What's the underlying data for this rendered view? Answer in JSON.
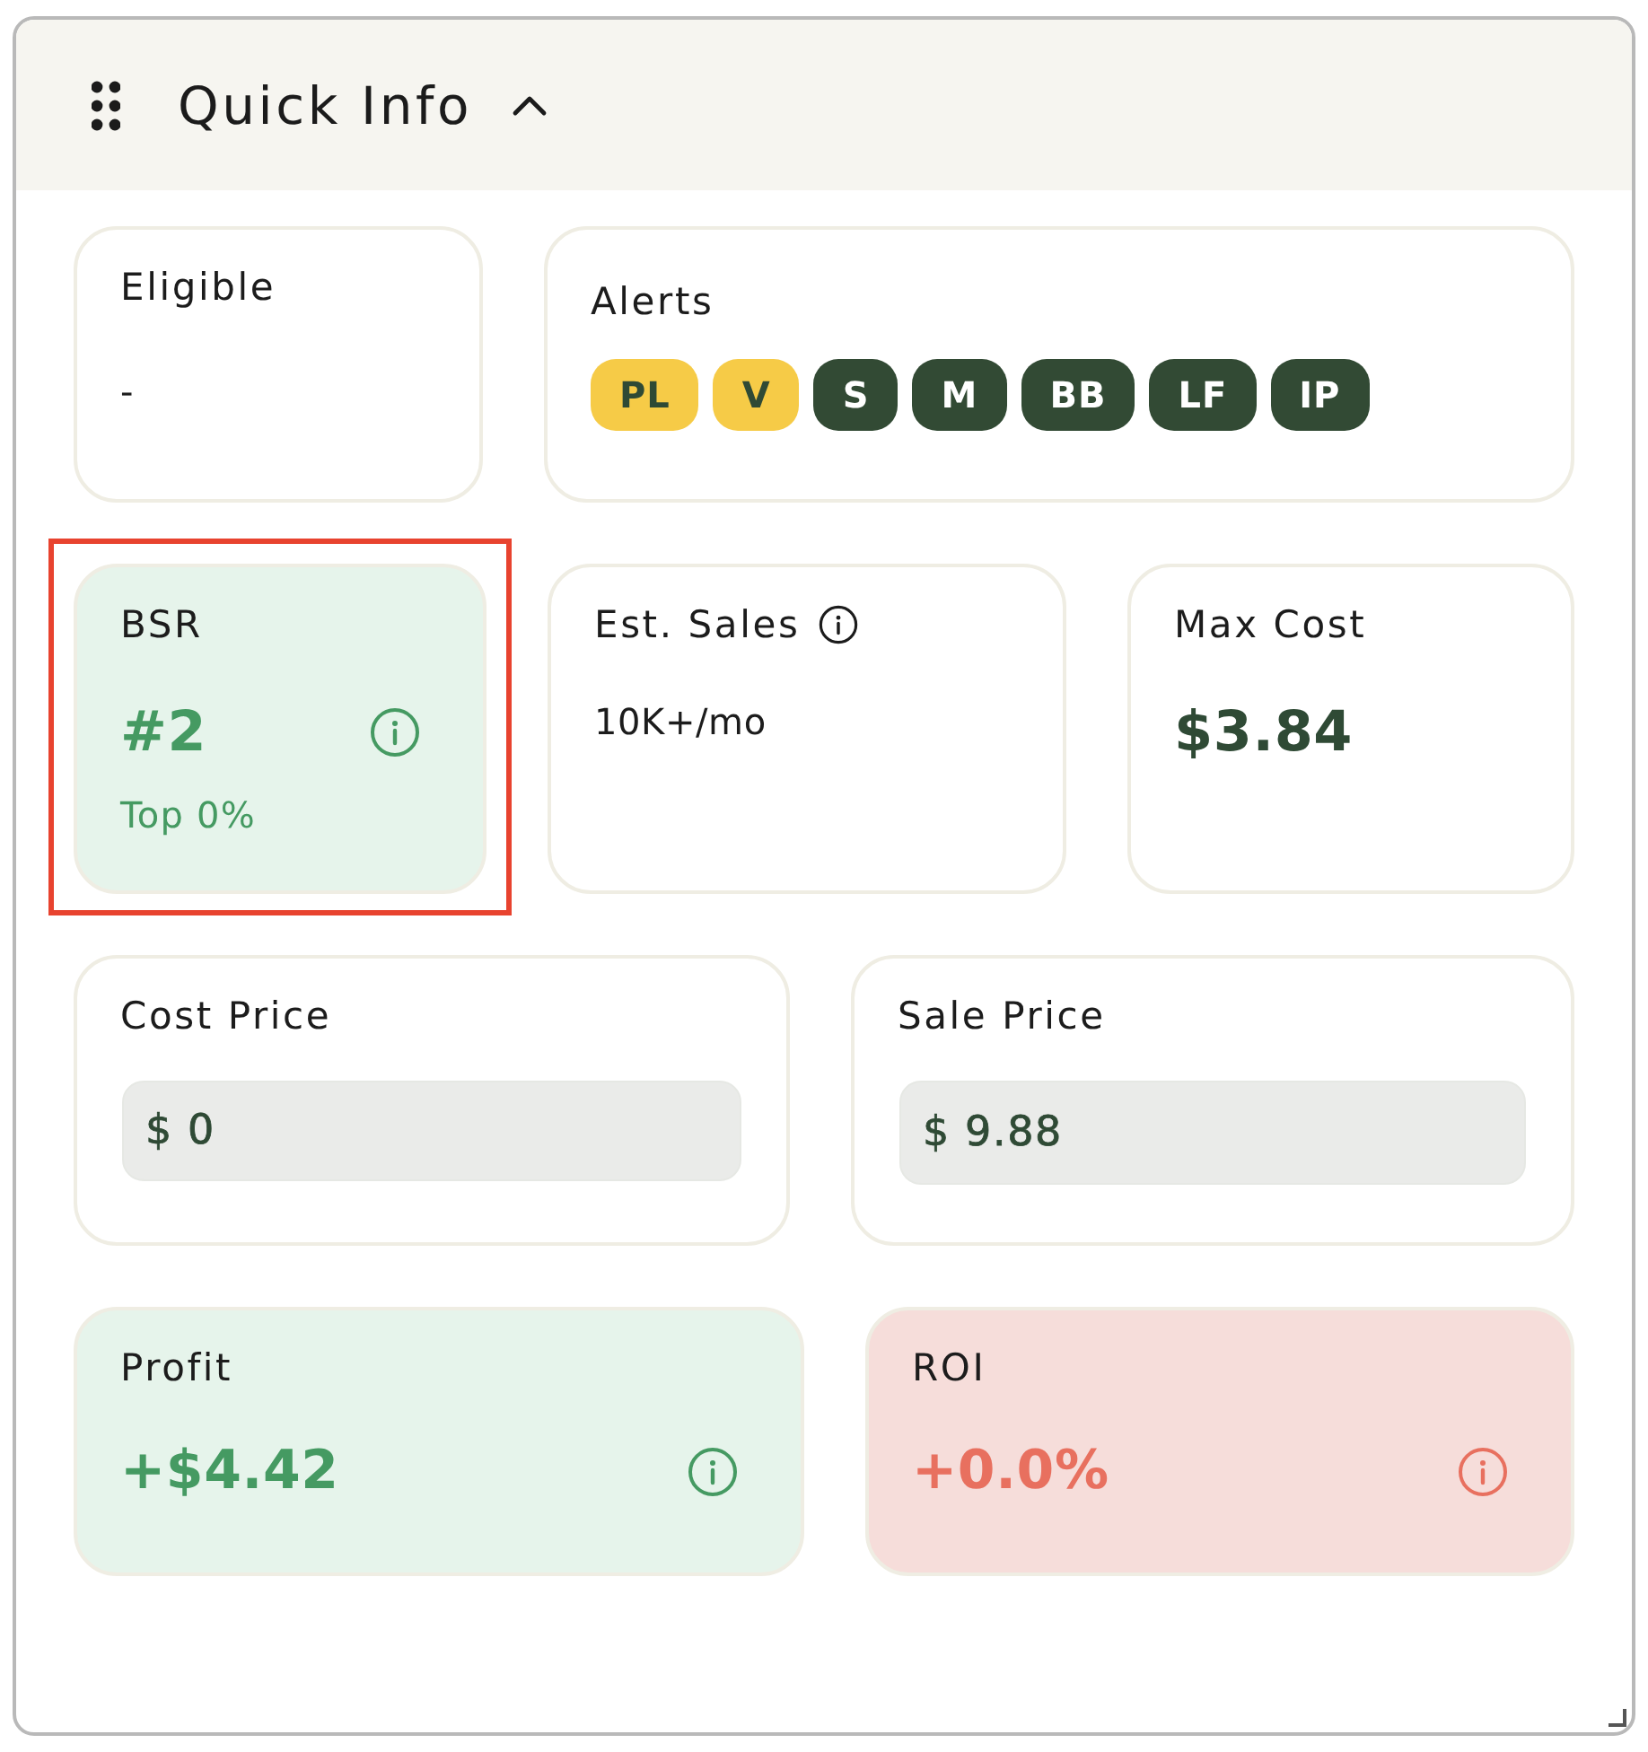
{
  "panel": {
    "title": "Quick Info",
    "expanded": true
  },
  "rows": [
    [
      {
        "kind": "text",
        "label": "Eligible",
        "value": "-"
      },
      {
        "kind": "alerts",
        "label": "Alerts",
        "badges": [
          {
            "text": "PL",
            "color": "#f6cb47"
          },
          {
            "text": "V",
            "color": "#f6cb47"
          },
          {
            "text": "S",
            "color": "#324a34"
          },
          {
            "text": "M",
            "color": "#324a34"
          },
          {
            "text": "BB",
            "color": "#324a34"
          },
          {
            "text": "LF",
            "color": "#324a34"
          },
          {
            "text": "IP",
            "color": "#324a34"
          }
        ]
      }
    ],
    [
      {
        "kind": "rank",
        "label": "BSR",
        "value": "#2",
        "sub": "Top 0%",
        "color": "#459a62",
        "info": true,
        "highlighted": true
      },
      {
        "kind": "text",
        "label": "Est. Sales",
        "value": "10K+/mo",
        "label_info": true
      },
      {
        "kind": "amount",
        "label": "Max Cost",
        "value": "$3.84"
      }
    ],
    [
      {
        "kind": "input",
        "label": "Cost Price",
        "value": "$ 0"
      },
      {
        "kind": "input",
        "label": "Sale Price",
        "value": "$ 9.88"
      }
    ],
    [
      {
        "kind": "metric",
        "label": "Profit",
        "value": "+$4.42",
        "color": "#459a62",
        "info": true
      },
      {
        "kind": "metric",
        "label": "ROI",
        "value": "+0.0%",
        "color": "#e8705f",
        "info": true
      }
    ]
  ]
}
